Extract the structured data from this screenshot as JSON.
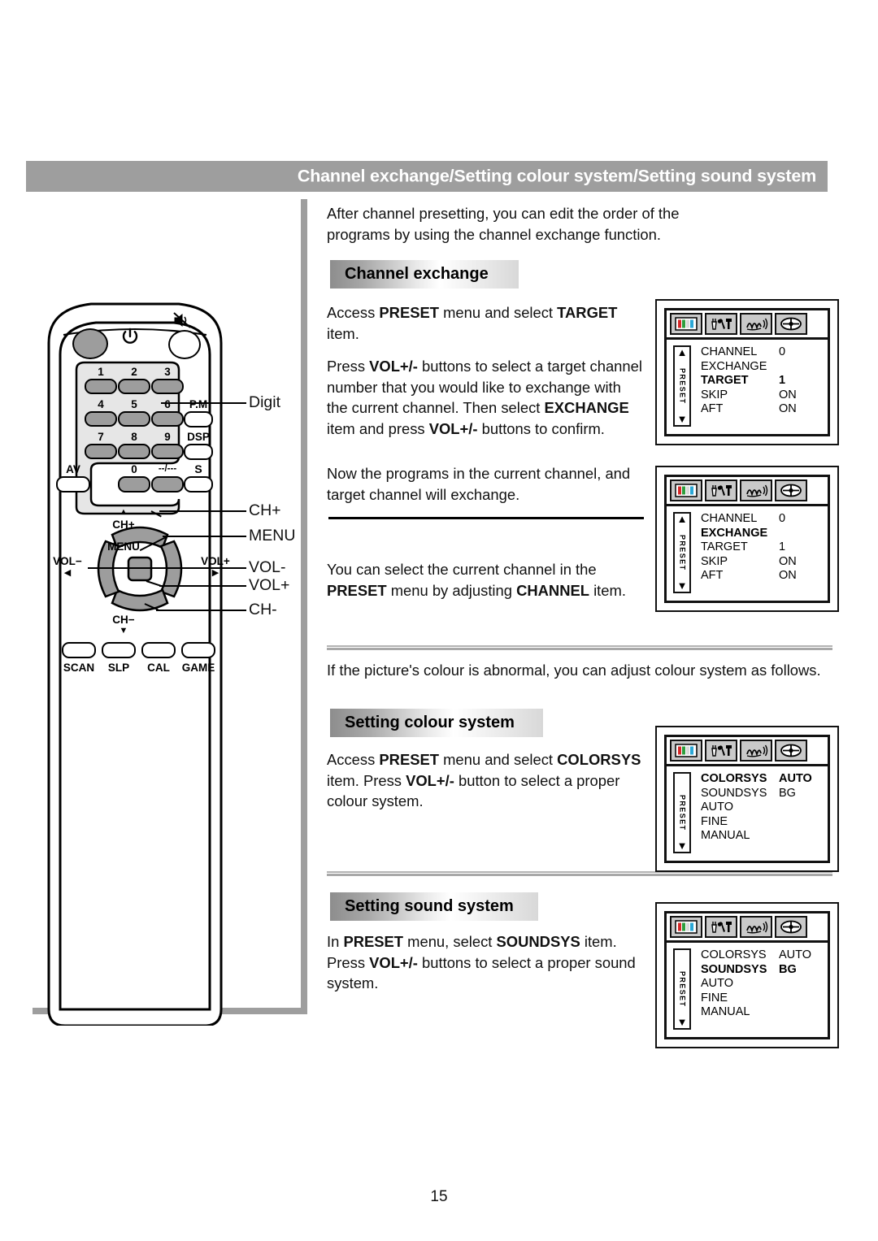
{
  "page": {
    "number": "15",
    "header_title": "Channel exchange/Setting colour system/Setting sound system"
  },
  "intro": {
    "line1": "After channel presetting, you can edit the order of the",
    "line2": "programs by using the channel exchange function."
  },
  "sections": {
    "channel_exchange": {
      "heading": "Channel exchange",
      "p1_a": "Access ",
      "p1_b": "PRESET",
      "p1_c": " menu and select ",
      "p1_d": "TARGET",
      "p1_e": " item.",
      "p2_a": "Press ",
      "p2_b": "VOL+/-",
      "p2_c": " buttons to select a target channel number that you would like to exchange with the current channel. Then select ",
      "p2_d": "EXCHANGE",
      "p2_e": " item and press ",
      "p2_f": "VOL+/-",
      "p2_g": " buttons to confirm.",
      "p3": "Now the programs in the current channel, and target channel will exchange.",
      "p4_a": "You can select the current channel in the ",
      "p4_b": "PRESET",
      "p4_c": " menu by adjusting ",
      "p4_d": "CHANNEL",
      "p4_e": " item."
    },
    "colour_system": {
      "intro": "If the picture's colour is abnormal, you can adjust colour system as follows.",
      "heading": "Setting colour system",
      "p1_a": "Access ",
      "p1_b": "PRESET",
      "p1_c": " menu and select ",
      "p1_d": "COLORSYS",
      "p1_e": " item. Press ",
      "p1_f": "VOL+/-",
      "p1_g": " button to select a proper colour system."
    },
    "sound_system": {
      "heading": "Setting sound system",
      "p1_a": "In ",
      "p1_b": "PRESET",
      "p1_c": " menu, select ",
      "p1_d": "SOUNDSYS",
      "p1_e": " item. Press ",
      "p1_f": "VOL+/-",
      "p1_g": " buttons to select a proper sound system."
    }
  },
  "osd_icons": [
    "colour-bars-icon",
    "tools-icon",
    "sound-wave-icon",
    "crosshair-icon"
  ],
  "osd": [
    {
      "name": "preset-target",
      "sidebar_label": "PRESET",
      "has_up_arrow": true,
      "has_down_arrow": true,
      "rows": [
        {
          "label": "CHANNEL",
          "value": "0",
          "selected": false
        },
        {
          "label": "EXCHANGE",
          "value": "",
          "selected": false
        },
        {
          "label": "TARGET",
          "value": "1",
          "selected": true
        },
        {
          "label": "SKIP",
          "value": "ON",
          "selected": false
        },
        {
          "label": "AFT",
          "value": "ON",
          "selected": false
        }
      ]
    },
    {
      "name": "preset-exchange",
      "sidebar_label": "PRESET",
      "has_up_arrow": true,
      "has_down_arrow": true,
      "rows": [
        {
          "label": "CHANNEL",
          "value": "0",
          "selected": false
        },
        {
          "label": "EXCHANGE",
          "value": "",
          "selected": true
        },
        {
          "label": "TARGET",
          "value": "1",
          "selected": false
        },
        {
          "label": "SKIP",
          "value": "ON",
          "selected": false
        },
        {
          "label": "AFT",
          "value": "ON",
          "selected": false
        }
      ]
    },
    {
      "name": "preset-colorsys",
      "sidebar_label": "PRESET",
      "has_up_arrow": false,
      "has_down_arrow": true,
      "rows": [
        {
          "label": "COLORSYS",
          "value": "AUTO",
          "selected": true
        },
        {
          "label": "SOUNDSYS",
          "value": "BG",
          "selected": false
        },
        {
          "label": "AUTO",
          "value": "",
          "selected": false
        },
        {
          "label": "FINE",
          "value": "",
          "selected": false
        },
        {
          "label": "MANUAL",
          "value": "",
          "selected": false
        }
      ]
    },
    {
      "name": "preset-soundsys",
      "sidebar_label": "PRESET",
      "has_up_arrow": false,
      "has_down_arrow": true,
      "rows": [
        {
          "label": "COLORSYS",
          "value": "AUTO",
          "selected": false
        },
        {
          "label": "SOUNDSYS",
          "value": "BG",
          "selected": true
        },
        {
          "label": "AUTO",
          "value": "",
          "selected": false
        },
        {
          "label": "FINE",
          "value": "",
          "selected": false
        },
        {
          "label": "MANUAL",
          "value": "",
          "selected": false
        }
      ]
    }
  ],
  "remote": {
    "power_icon": "power-icon",
    "mute_icon": "mute-icon",
    "keys": {
      "digits": [
        "1",
        "2",
        "3",
        "4",
        "5",
        "6",
        "7",
        "8",
        "9",
        "0",
        "--/---"
      ],
      "av": "AV",
      "pm": "P.M",
      "dsp": "DSP",
      "s": "S",
      "menu": "MENU",
      "ch_up": "CH+",
      "ch_down": "CH−",
      "vol_down": "VOL−",
      "vol_up": "VOL+",
      "bottom": [
        "SCAN",
        "SLP",
        "CAL",
        "GAME"
      ]
    },
    "callouts": [
      "Digit",
      "CH+",
      "MENU",
      "VOL-",
      "VOL+",
      "CH-"
    ]
  }
}
